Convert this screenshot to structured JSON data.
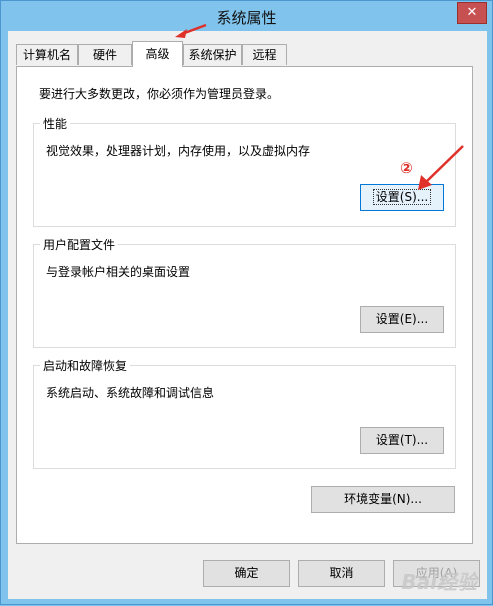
{
  "window": {
    "title": "系统属性",
    "close_label": "✕"
  },
  "tabs": [
    {
      "label": "计算机名"
    },
    {
      "label": "硬件"
    },
    {
      "label": "高级"
    },
    {
      "label": "系统保护"
    },
    {
      "label": "远程"
    }
  ],
  "active_tab": "高级",
  "admin_note": "要进行大多数更改，你必须作为管理员登录。",
  "groups": {
    "performance": {
      "title": "性能",
      "description": "视觉效果，处理器计划，内存使用，以及虚拟内存",
      "button": "设置(S)..."
    },
    "user_profiles": {
      "title": "用户配置文件",
      "description": "与登录帐户相关的桌面设置",
      "button": "设置(E)..."
    },
    "startup_recovery": {
      "title": "启动和故障恢复",
      "description": "系统启动、系统故障和调试信息",
      "button": "设置(T)..."
    }
  },
  "env_button": "环境变量(N)...",
  "footer": {
    "ok": "确定",
    "cancel": "取消",
    "apply": "应用(A)"
  },
  "annotation": {
    "step_marker": "②",
    "color": "#e0302a"
  },
  "watermark": "Bai经验"
}
